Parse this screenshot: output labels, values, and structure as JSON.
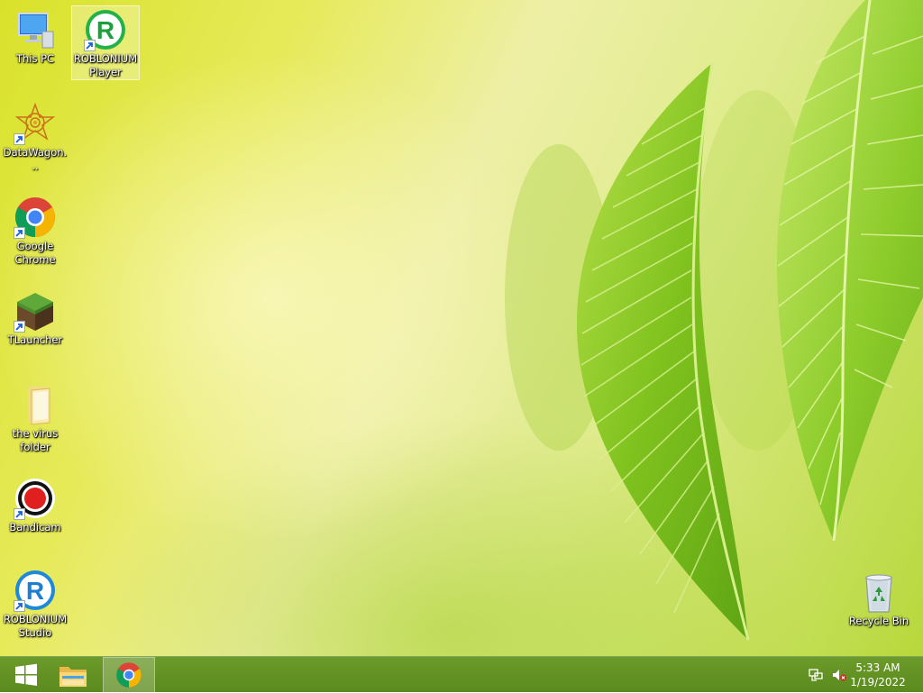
{
  "desktop": {
    "icons": [
      {
        "id": "this-pc",
        "label": "This PC",
        "icon": "computer-icon"
      },
      {
        "id": "roblonium-player",
        "label": "ROBLONIUM Player",
        "icon": "roblonium-player-icon",
        "selected": true
      },
      {
        "id": "datawagon",
        "label": "DataWagon...",
        "icon": "datawagon-icon"
      },
      {
        "id": "google-chrome",
        "label": "Google Chrome",
        "icon": "chrome-icon"
      },
      {
        "id": "tlauncher",
        "label": "TLauncher",
        "icon": "tlauncher-icon"
      },
      {
        "id": "virus-folder",
        "label": "the virus folder",
        "icon": "folder-icon"
      },
      {
        "id": "bandicam",
        "label": "Bandicam",
        "icon": "bandicam-icon"
      },
      {
        "id": "roblonium-studio",
        "label": "ROBLONIUM Studio",
        "icon": "roblonium-studio-icon"
      },
      {
        "id": "recycle-bin",
        "label": "Recycle Bin",
        "icon": "recycle-bin-icon"
      }
    ]
  },
  "taskbar": {
    "start_icon": "windows-start-icon",
    "pinned": [
      {
        "id": "file-explorer",
        "icon": "file-explorer-icon"
      },
      {
        "id": "chrome",
        "icon": "chrome-icon",
        "active": true
      }
    ],
    "tray": {
      "network_icon": "network-icon",
      "volume_icon": "volume-muted-icon",
      "time": "5:33 AM",
      "date": "1/19/2022"
    }
  },
  "colors": {
    "taskbar": "#5f8e22",
    "wallpaper_accent": "#8fc31f"
  }
}
